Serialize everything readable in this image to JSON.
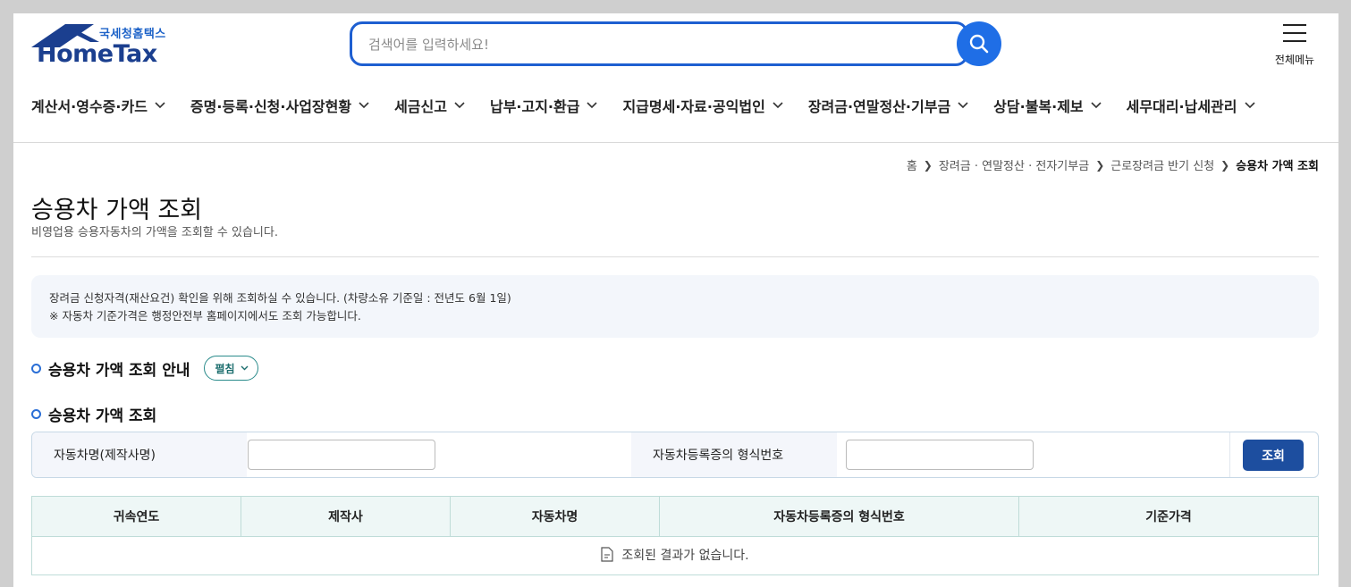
{
  "header": {
    "logo": {
      "korean": "국세청홈택스",
      "english": "HomeTax"
    },
    "search": {
      "placeholder": "검색어를 입력하세요!",
      "value": ""
    },
    "all_menu_label": "전체메뉴",
    "nav": [
      {
        "label": "계산서·영수증·카드"
      },
      {
        "label": "증명·등록·신청·사업장현황"
      },
      {
        "label": "세금신고"
      },
      {
        "label": "납부·고지·환급"
      },
      {
        "label": "지급명세·자료·공익법인"
      },
      {
        "label": "장려금·연말정산·기부금"
      },
      {
        "label": "상담·불복·제보"
      },
      {
        "label": "세무대리·납세관리"
      }
    ]
  },
  "breadcrumb": {
    "home": "홈",
    "level1": "장려금 · 연말정산 · 전자기부금",
    "level2": "근로장려금 반기 신청",
    "current": "승용차 가액 조회"
  },
  "page": {
    "title": "승용차 가액 조회",
    "subtitle": "비영업용 승용자동차의 가액을 조회할 수 있습니다.",
    "notice_line1": "장려금 신청자격(재산요건) 확인을 위해 조회하실 수 있습니다. (차량소유 기준일 : 전년도 6월 1일)",
    "notice_line2": "※ 자동차 기준가격은 행정안전부 홈페이지에서도 조회 가능합니다."
  },
  "guide_section": {
    "title": "승용차 가액 조회 안내",
    "toggle_label": "펼침"
  },
  "search_section": {
    "title": "승용차 가액 조회",
    "car_name_label": "자동차명(제작사명)",
    "car_name_value": "",
    "model_no_label": "자동차등록증의 형식번호",
    "model_no_value": "",
    "search_button": "조회"
  },
  "results": {
    "columns": [
      "귀속연도",
      "제작사",
      "자동차명",
      "자동차등록증의 형식번호",
      "기준가격"
    ],
    "empty_message": "조회된 결과가 없습니다."
  },
  "colors": {
    "primary_blue": "#1f6ee6",
    "logo_navy": "#1b3f8f",
    "button_navy": "#1d4e9f",
    "table_header_bg": "#eef7f6",
    "toggle_teal": "#1c6e6e"
  }
}
